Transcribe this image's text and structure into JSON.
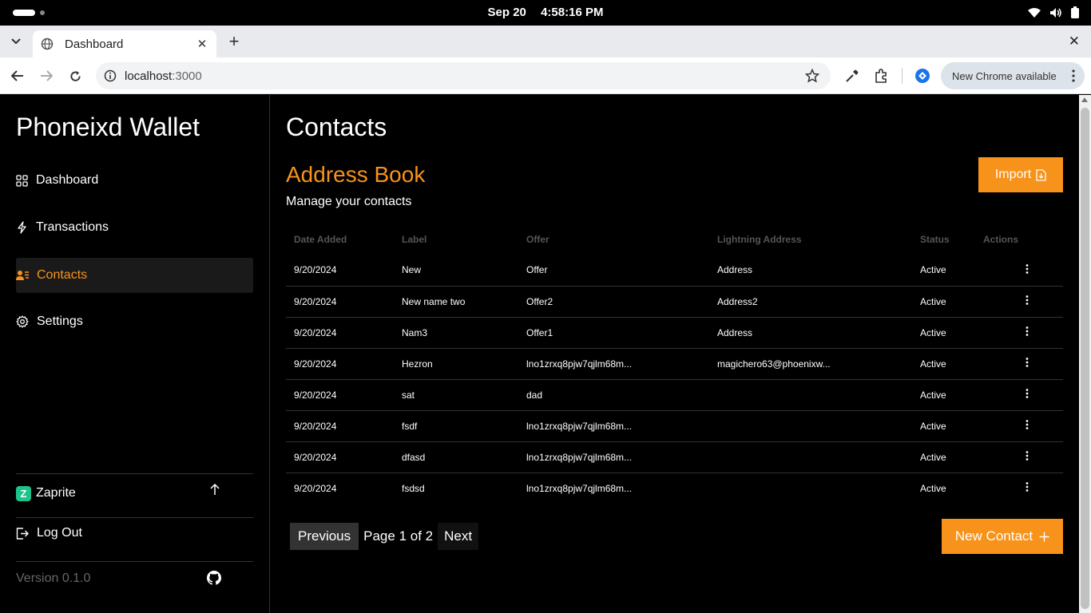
{
  "os": {
    "date": "Sep 20",
    "time": "4:58:16 PM"
  },
  "browser": {
    "tab_title": "Dashboard",
    "url_host": "localhost",
    "url_port": ":3000",
    "update_label": "New Chrome available"
  },
  "sidebar": {
    "brand": "Phoneixd Wallet",
    "items": [
      {
        "label": "Dashboard",
        "icon": "grid-icon"
      },
      {
        "label": "Transactions",
        "icon": "bolt-icon"
      },
      {
        "label": "Contacts",
        "icon": "contacts-icon",
        "active": true
      },
      {
        "label": "Settings",
        "icon": "gear-icon"
      }
    ],
    "zaprite": {
      "logo_letter": "Z",
      "label": "Zaprite"
    },
    "logout": "Log Out",
    "version": "Version 0.1.0"
  },
  "main": {
    "title": "Contacts",
    "section_title": "Address Book",
    "section_subtitle": "Manage your contacts",
    "import_label": "Import",
    "columns": [
      "Date Added",
      "Label",
      "Offer",
      "Lightning Address",
      "Status",
      "Actions"
    ],
    "rows": [
      {
        "date": "9/20/2024",
        "label": "New",
        "offer": "Offer",
        "address": "Address",
        "status": "Active"
      },
      {
        "date": "9/20/2024",
        "label": "New name two",
        "offer": "Offer2",
        "address": "Address2",
        "status": "Active"
      },
      {
        "date": "9/20/2024",
        "label": "Nam3",
        "offer": "Offer1",
        "address": "Address",
        "status": "Active"
      },
      {
        "date": "9/20/2024",
        "label": "Hezron",
        "offer": "lno1zrxq8pjw7qjlm68m...",
        "address": "magichero63@phoenixw...",
        "status": "Active"
      },
      {
        "date": "9/20/2024",
        "label": "sat",
        "offer": "dad",
        "address": "",
        "status": "Active"
      },
      {
        "date": "9/20/2024",
        "label": "fsdf",
        "offer": "lno1zrxq8pjw7qjlm68m...",
        "address": "",
        "status": "Active"
      },
      {
        "date": "9/20/2024",
        "label": "dfasd",
        "offer": "lno1zrxq8pjw7qjlm68m...",
        "address": "",
        "status": "Active"
      },
      {
        "date": "9/20/2024",
        "label": "fsdsd",
        "offer": "lno1zrxq8pjw7qjlm68m...",
        "address": "",
        "status": "Active"
      }
    ],
    "pagination": {
      "previous": "Previous",
      "info": "Page 1 of 2",
      "next": "Next"
    },
    "new_contact_label": "New Contact"
  },
  "colors": {
    "accent": "#f7931a",
    "background": "#000000",
    "zaprite": "#1ec28b"
  }
}
